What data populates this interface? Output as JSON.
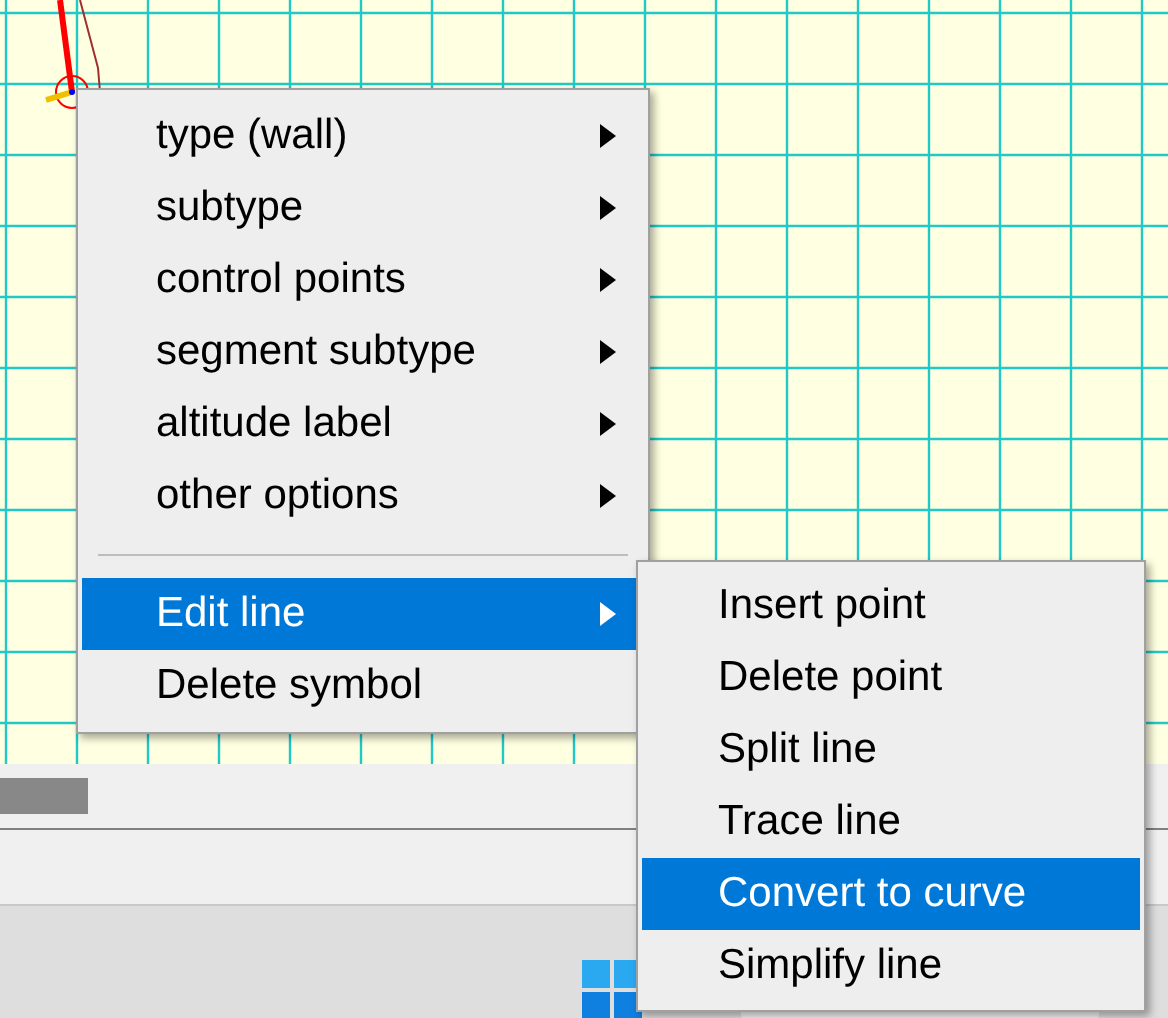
{
  "context_menu": {
    "items": [
      {
        "kind": "item",
        "label": "type (wall)",
        "submenu": true,
        "selected": false
      },
      {
        "kind": "item",
        "label": "subtype",
        "submenu": true,
        "selected": false
      },
      {
        "kind": "item",
        "label": "control points",
        "submenu": true,
        "selected": false
      },
      {
        "kind": "item",
        "label": "segment subtype",
        "submenu": true,
        "selected": false
      },
      {
        "kind": "item",
        "label": "altitude label",
        "submenu": true,
        "selected": false
      },
      {
        "kind": "item",
        "label": "other options",
        "submenu": true,
        "selected": false
      },
      {
        "kind": "separator"
      },
      {
        "kind": "item",
        "label": "Edit line",
        "submenu": true,
        "selected": true
      },
      {
        "kind": "item",
        "label": "Delete symbol",
        "submenu": false,
        "selected": false
      }
    ]
  },
  "submenu": {
    "items": [
      {
        "label": "Insert point",
        "selected": false
      },
      {
        "label": "Delete point",
        "selected": false
      },
      {
        "label": "Split line",
        "selected": false
      },
      {
        "label": "Trace line",
        "selected": false
      },
      {
        "label": "Convert to curve",
        "selected": true
      },
      {
        "label": "Simplify line",
        "selected": false
      }
    ]
  }
}
